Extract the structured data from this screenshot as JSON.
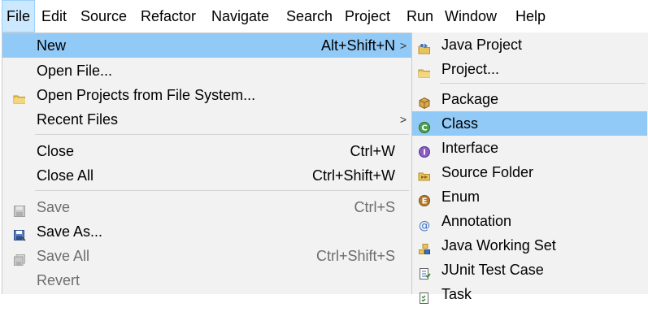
{
  "menubar": {
    "items": [
      {
        "label": "File"
      },
      {
        "label": "Edit"
      },
      {
        "label": "Source"
      },
      {
        "label": "Refactor"
      },
      {
        "label": "Navigate"
      },
      {
        "label": "Search"
      },
      {
        "label": "Project"
      },
      {
        "label": "Run"
      },
      {
        "label": "Window"
      },
      {
        "label": "Help"
      }
    ],
    "active_item": "File"
  },
  "file_menu": {
    "items": [
      {
        "label": "New",
        "shortcut": "Alt+Shift+N",
        "submenu": true,
        "highlighted": true
      },
      {
        "label": "Open File..."
      },
      {
        "label": "Open Projects from File System...",
        "icon": "folder-icon"
      },
      {
        "label": "Recent Files",
        "submenu": true
      },
      {
        "label": "Close",
        "shortcut": "Ctrl+W"
      },
      {
        "label": "Close All",
        "shortcut": "Ctrl+Shift+W"
      },
      {
        "label": "Save",
        "shortcut": "Ctrl+S",
        "icon": "save-icon",
        "disabled": true
      },
      {
        "label": "Save As...",
        "icon": "save-as-icon"
      },
      {
        "label": "Save All",
        "shortcut": "Ctrl+Shift+S",
        "icon": "save-all-icon",
        "disabled": true
      },
      {
        "label": "Revert",
        "disabled": true
      }
    ],
    "submenu_arrow": ">"
  },
  "new_submenu": {
    "items": [
      {
        "label": "Java Project",
        "icon": "java-project-icon"
      },
      {
        "label": "Project...",
        "icon": "project-icon"
      },
      {
        "label": "Package",
        "icon": "package-icon"
      },
      {
        "label": "Class",
        "icon": "class-icon",
        "highlighted": true
      },
      {
        "label": "Interface",
        "icon": "interface-icon"
      },
      {
        "label": "Source Folder",
        "icon": "source-folder-icon"
      },
      {
        "label": "Enum",
        "icon": "enum-icon"
      },
      {
        "label": "Annotation",
        "icon": "annotation-icon"
      },
      {
        "label": "Java Working Set",
        "icon": "working-set-icon"
      },
      {
        "label": "JUnit Test Case",
        "icon": "junit-icon"
      },
      {
        "label": "Task",
        "icon": "task-icon"
      }
    ]
  },
  "colors": {
    "menubar_active_bg": "#cce8ff",
    "menu_bg": "#f2f2f2",
    "highlight_bg": "#91c9f7",
    "disabled_text": "#6d6d6d",
    "separator": "#d4d4d4"
  }
}
